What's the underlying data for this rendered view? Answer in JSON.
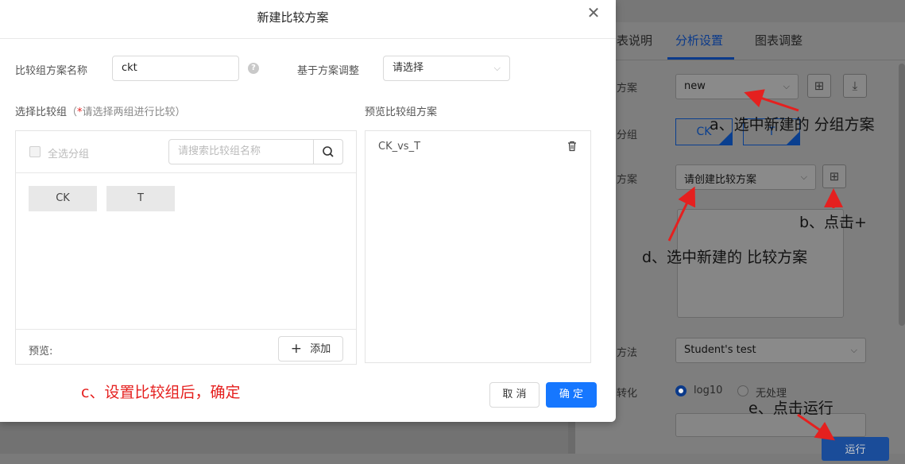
{
  "modal": {
    "title": "新建比较方案",
    "name_label": "比较组方案名称",
    "name_value": "ckt",
    "based_on_label": "基于方案调整",
    "based_on_placeholder": "请选择",
    "select_groups_label": "选择比较组",
    "select_groups_hint": "（*请选择两组进行比较）",
    "preview_label": "预览比较组方案",
    "select_all_label": "全选分组",
    "search_placeholder": "请搜索比较组名称",
    "groups": [
      "CK",
      "T"
    ],
    "preview_footer_label": "预览:",
    "add_label": "添加",
    "preview_items": [
      "CK_vs_T"
    ],
    "cancel_label": "取 消",
    "ok_label": "确 定"
  },
  "background": {
    "tabs": [
      "表说明",
      "分析设置",
      "图表调整"
    ],
    "active_tab": "分析设置",
    "row_labels": [
      "方案",
      "分组",
      "方案",
      "方法",
      "转化"
    ],
    "group_scheme_value": "new",
    "group_tags": [
      "CK",
      "T"
    ],
    "compare_scheme_placeholder": "请创建比较方案",
    "method_value": "Student's test",
    "transform_options": [
      "log10",
      "无处理"
    ],
    "run_label": "运行"
  },
  "annotations": {
    "a": "a、选中新建的 分组方案",
    "b": "b、点击+",
    "c": "c、设置比较组后，确定",
    "d": "d、选中新建的 比较方案",
    "e": "e、点击运行"
  },
  "colors": {
    "primary": "#1677ff",
    "annotation": "#e5201f",
    "active_tab": "#0b3a8a"
  }
}
